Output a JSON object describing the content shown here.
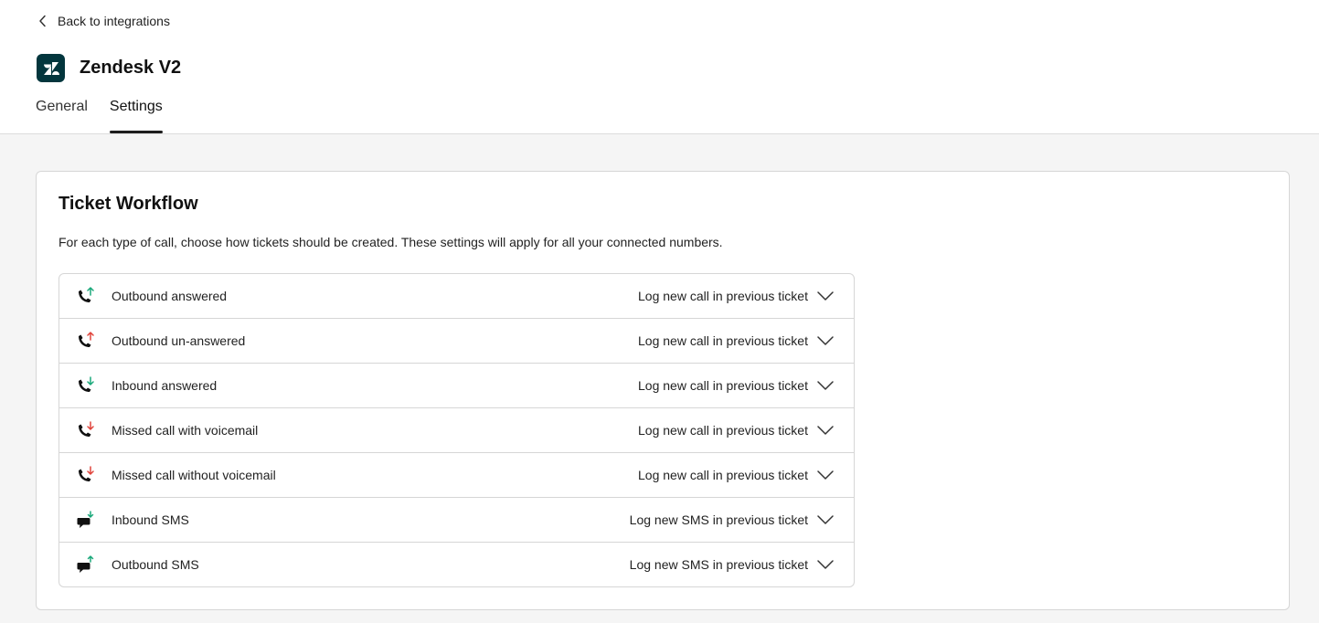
{
  "nav": {
    "back_label": "Back to integrations"
  },
  "app": {
    "title": "Zendesk V2"
  },
  "tabs": [
    {
      "label": "General",
      "active": false
    },
    {
      "label": "Settings",
      "active": true
    }
  ],
  "workflow": {
    "title": "Ticket Workflow",
    "description": "For each type of call, choose how tickets should be created. These settings will apply for all your connected numbers.",
    "rows": [
      {
        "label": "Outbound answered",
        "value": "Log new call in previous ticket",
        "icon": "phone-outbound-answered-icon"
      },
      {
        "label": "Outbound un-answered",
        "value": "Log new call in previous ticket",
        "icon": "phone-outbound-unanswered-icon"
      },
      {
        "label": "Inbound answered",
        "value": "Log new call in previous ticket",
        "icon": "phone-inbound-answered-icon"
      },
      {
        "label": "Missed call with voicemail",
        "value": "Log new call in previous ticket",
        "icon": "phone-missed-voicemail-icon"
      },
      {
        "label": "Missed call without voicemail",
        "value": "Log new call in previous ticket",
        "icon": "phone-missed-no-voicemail-icon"
      },
      {
        "label": "Inbound SMS",
        "value": "Log new SMS in previous ticket",
        "icon": "sms-inbound-icon"
      },
      {
        "label": "Outbound SMS",
        "value": "Log new SMS in previous ticket",
        "icon": "sms-outbound-icon"
      }
    ]
  },
  "colors": {
    "logo_bg": "#03363d",
    "green_arrow": "#1aa87a",
    "red_arrow": "#e0443b"
  }
}
